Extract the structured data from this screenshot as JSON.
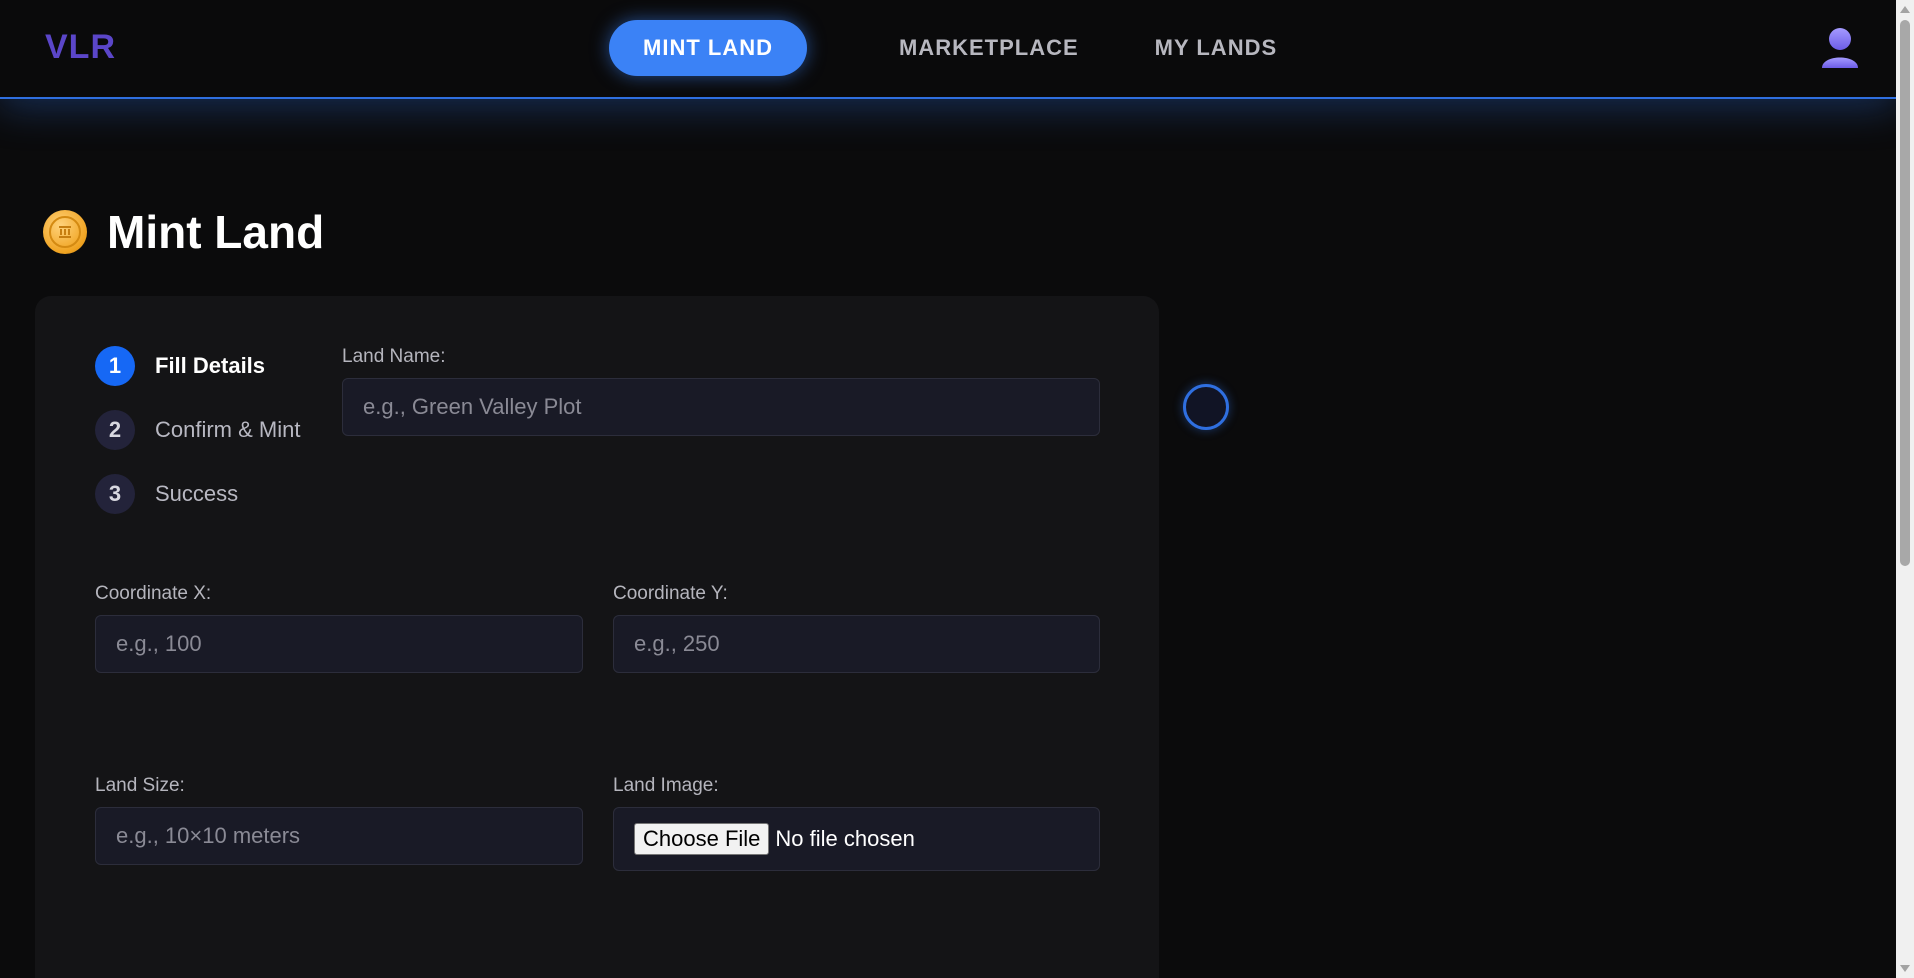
{
  "app": {
    "logo": "VLR"
  },
  "nav": {
    "items": [
      {
        "label": "MINT LAND",
        "active": true
      },
      {
        "label": "MARKETPLACE",
        "active": false
      },
      {
        "label": "MY LANDS",
        "active": false
      }
    ]
  },
  "page": {
    "title": "Mint Land",
    "title_icon": "coin-icon"
  },
  "stepper": {
    "steps": [
      {
        "number": "1",
        "label": "Fill Details",
        "active": true
      },
      {
        "number": "2",
        "label": "Confirm & Mint",
        "active": false
      },
      {
        "number": "3",
        "label": "Success",
        "active": false
      }
    ]
  },
  "form": {
    "land_name": {
      "label": "Land Name:",
      "placeholder": "e.g., Green Valley Plot",
      "value": ""
    },
    "coord_x": {
      "label": "Coordinate X:",
      "placeholder": "e.g., 100",
      "value": ""
    },
    "coord_y": {
      "label": "Coordinate Y:",
      "placeholder": "e.g., 250",
      "value": ""
    },
    "land_size": {
      "label": "Land Size:",
      "placeholder": "e.g., 10×10 meters",
      "value": ""
    },
    "land_image": {
      "label": "Land Image:",
      "button": "Choose File",
      "status": "No file chosen"
    }
  },
  "colors": {
    "accent": "#3b82f6",
    "logo": "#5b46c9",
    "background": "#0b0b0c",
    "card": "#141416"
  }
}
